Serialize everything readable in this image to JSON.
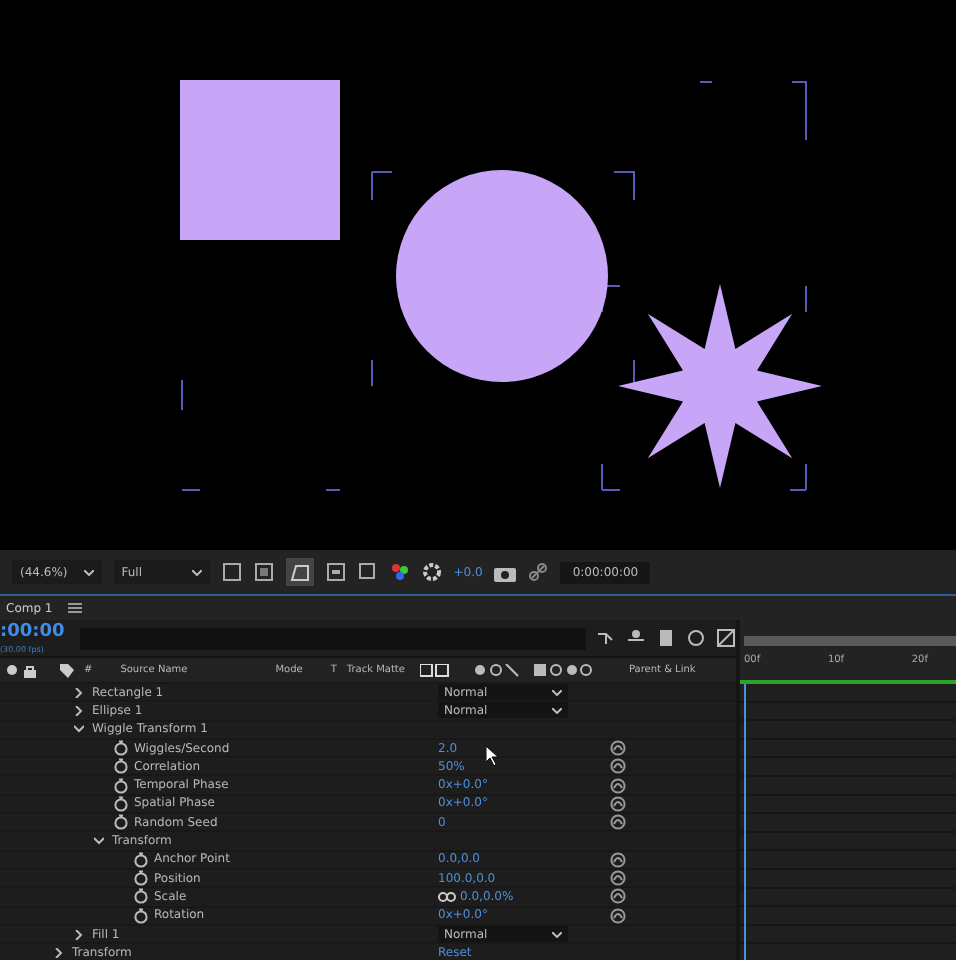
{
  "viewer_toolbar": {
    "zoom": "(44.6%)",
    "resolution": "Full",
    "exposure": "+0.0",
    "timecode": "0:00:00:00"
  },
  "panel": {
    "tab": "Comp 1"
  },
  "timeline": {
    "timecode": ":00:00",
    "fps": "(30.00 fps)",
    "ruler": [
      "00f",
      "10f",
      "20f"
    ]
  },
  "columns": {
    "number": "#",
    "source_name": "Source Name",
    "mode": "Mode",
    "t": "T",
    "track_matte": "Track Matte",
    "parent": "Parent & Link"
  },
  "contents": [
    {
      "kind": "group",
      "name": "Rectangle 1",
      "expanded": false,
      "mode": "Normal"
    },
    {
      "kind": "group",
      "name": "Ellipse 1",
      "expanded": false,
      "mode": "Normal"
    },
    {
      "kind": "group",
      "name": "Wiggle Transform 1",
      "expanded": true,
      "children": [
        {
          "kind": "property",
          "name": "Wiggles/Second",
          "value": "2.0"
        },
        {
          "kind": "property",
          "name": "Correlation",
          "value": "50%"
        },
        {
          "kind": "property",
          "name": "Temporal Phase",
          "value": "0x+0.0°"
        },
        {
          "kind": "property",
          "name": "Spatial Phase",
          "value": "0x+0.0°"
        },
        {
          "kind": "property",
          "name": "Random Seed",
          "value": "0"
        },
        {
          "kind": "group",
          "name": "Transform",
          "expanded": true,
          "children": [
            {
              "kind": "property",
              "name": "Anchor Point",
              "value": "0.0,0.0"
            },
            {
              "kind": "property",
              "name": "Position",
              "value": "100.0,0.0"
            },
            {
              "kind": "property",
              "name": "Scale",
              "value": "0.0,0.0%",
              "linked": true
            },
            {
              "kind": "property",
              "name": "Rotation",
              "value": "0x+0.0°"
            }
          ]
        }
      ]
    },
    {
      "kind": "group",
      "name": "Fill 1",
      "expanded": false,
      "mode": "Normal"
    }
  ],
  "layer_transform": {
    "name": "Transform",
    "expanded": false,
    "value": "Reset"
  }
}
